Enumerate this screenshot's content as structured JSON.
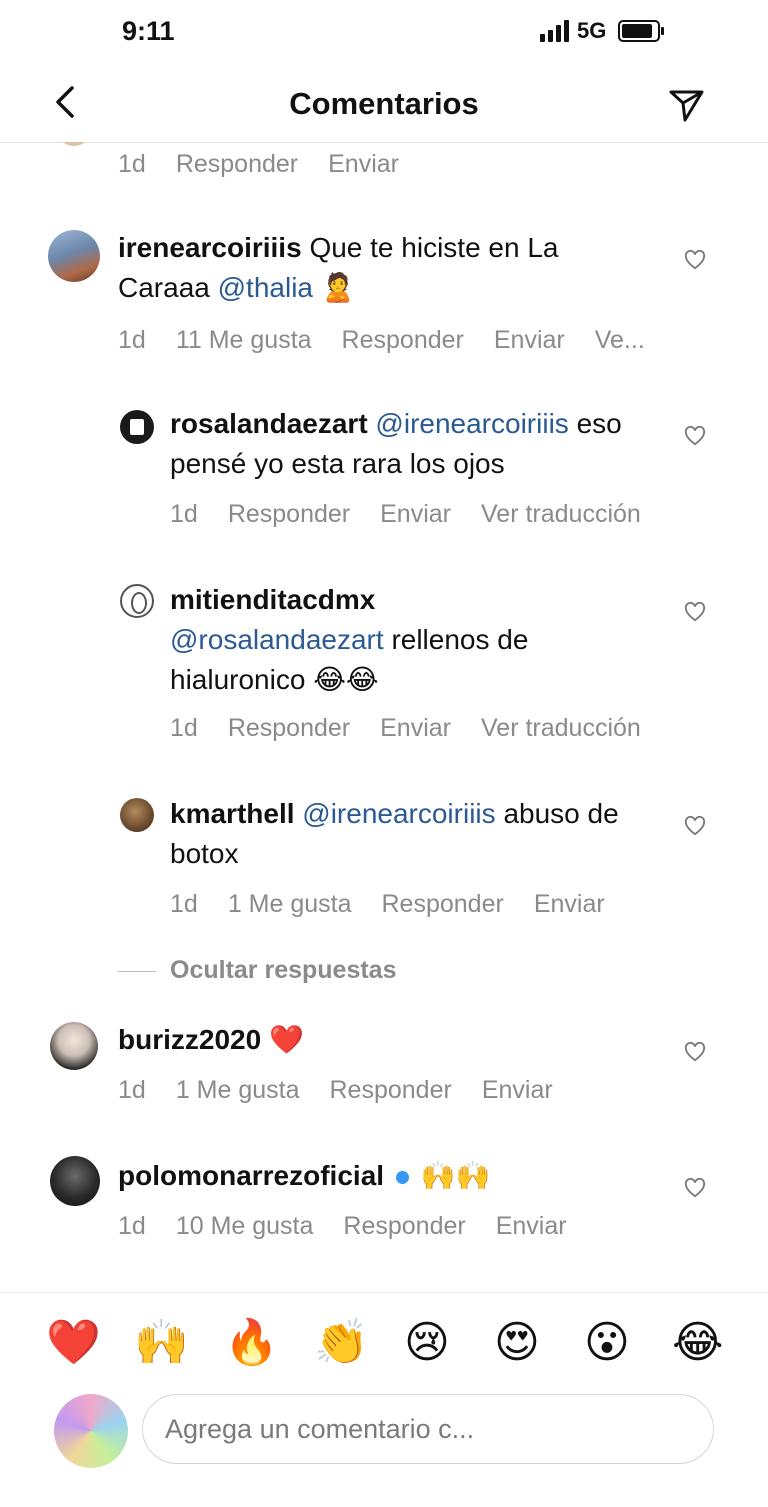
{
  "status_bar": {
    "time": "9:11",
    "network": "5G"
  },
  "header": {
    "title": "Comentarios"
  },
  "top_meta": {
    "time": "1d",
    "reply": "Responder",
    "send": "Enviar"
  },
  "comments": [
    {
      "username": "irenearcoiriiis",
      "text_before": "Que te hiciste en La Caraaa",
      "mention": "@thalia",
      "emoji": "🙎",
      "time": "1d",
      "likes": "11 Me gusta",
      "reply": "Responder",
      "send": "Enviar",
      "extra": "Ve..."
    },
    {
      "username": "rosalandaezart",
      "mention": "@irenearcoiriiis",
      "text_after": "eso pensé yo esta rara los ojos",
      "time": "1d",
      "reply": "Responder",
      "send": "Enviar",
      "translate": "Ver traducción"
    },
    {
      "username": "mitienditacdmx",
      "mention": "@rosalandaezart",
      "text_after": "rellenos de hialuronico",
      "emoji": "😂😂",
      "time": "1d",
      "reply": "Responder",
      "send": "Enviar",
      "translate": "Ver traducción"
    },
    {
      "username": "kmarthell",
      "mention": "@irenearcoiriiis",
      "text_after": "abuso de botox",
      "time": "1d",
      "likes": "1 Me gusta",
      "reply": "Responder",
      "send": "Enviar"
    },
    {
      "username": "burizz2020",
      "emoji": "❤️",
      "time": "1d",
      "likes": "1 Me gusta",
      "reply": "Responder",
      "send": "Enviar"
    },
    {
      "username": "polomonarrezoficial",
      "emoji": "🙌🙌",
      "time": "1d",
      "likes": "10 Me gusta",
      "reply": "Responder",
      "send": "Enviar"
    }
  ],
  "hide_replies": "Ocultar respuestas",
  "emoji_bar": [
    "❤️",
    "🙌",
    "🔥",
    "👏",
    "😢",
    "😍",
    "😮",
    "😂"
  ],
  "composer": {
    "placeholder": "Agrega un comentario c..."
  },
  "colors": {
    "mention": "#2b5a93",
    "meta": "#8a8a8a",
    "verified": "#3897f0"
  }
}
